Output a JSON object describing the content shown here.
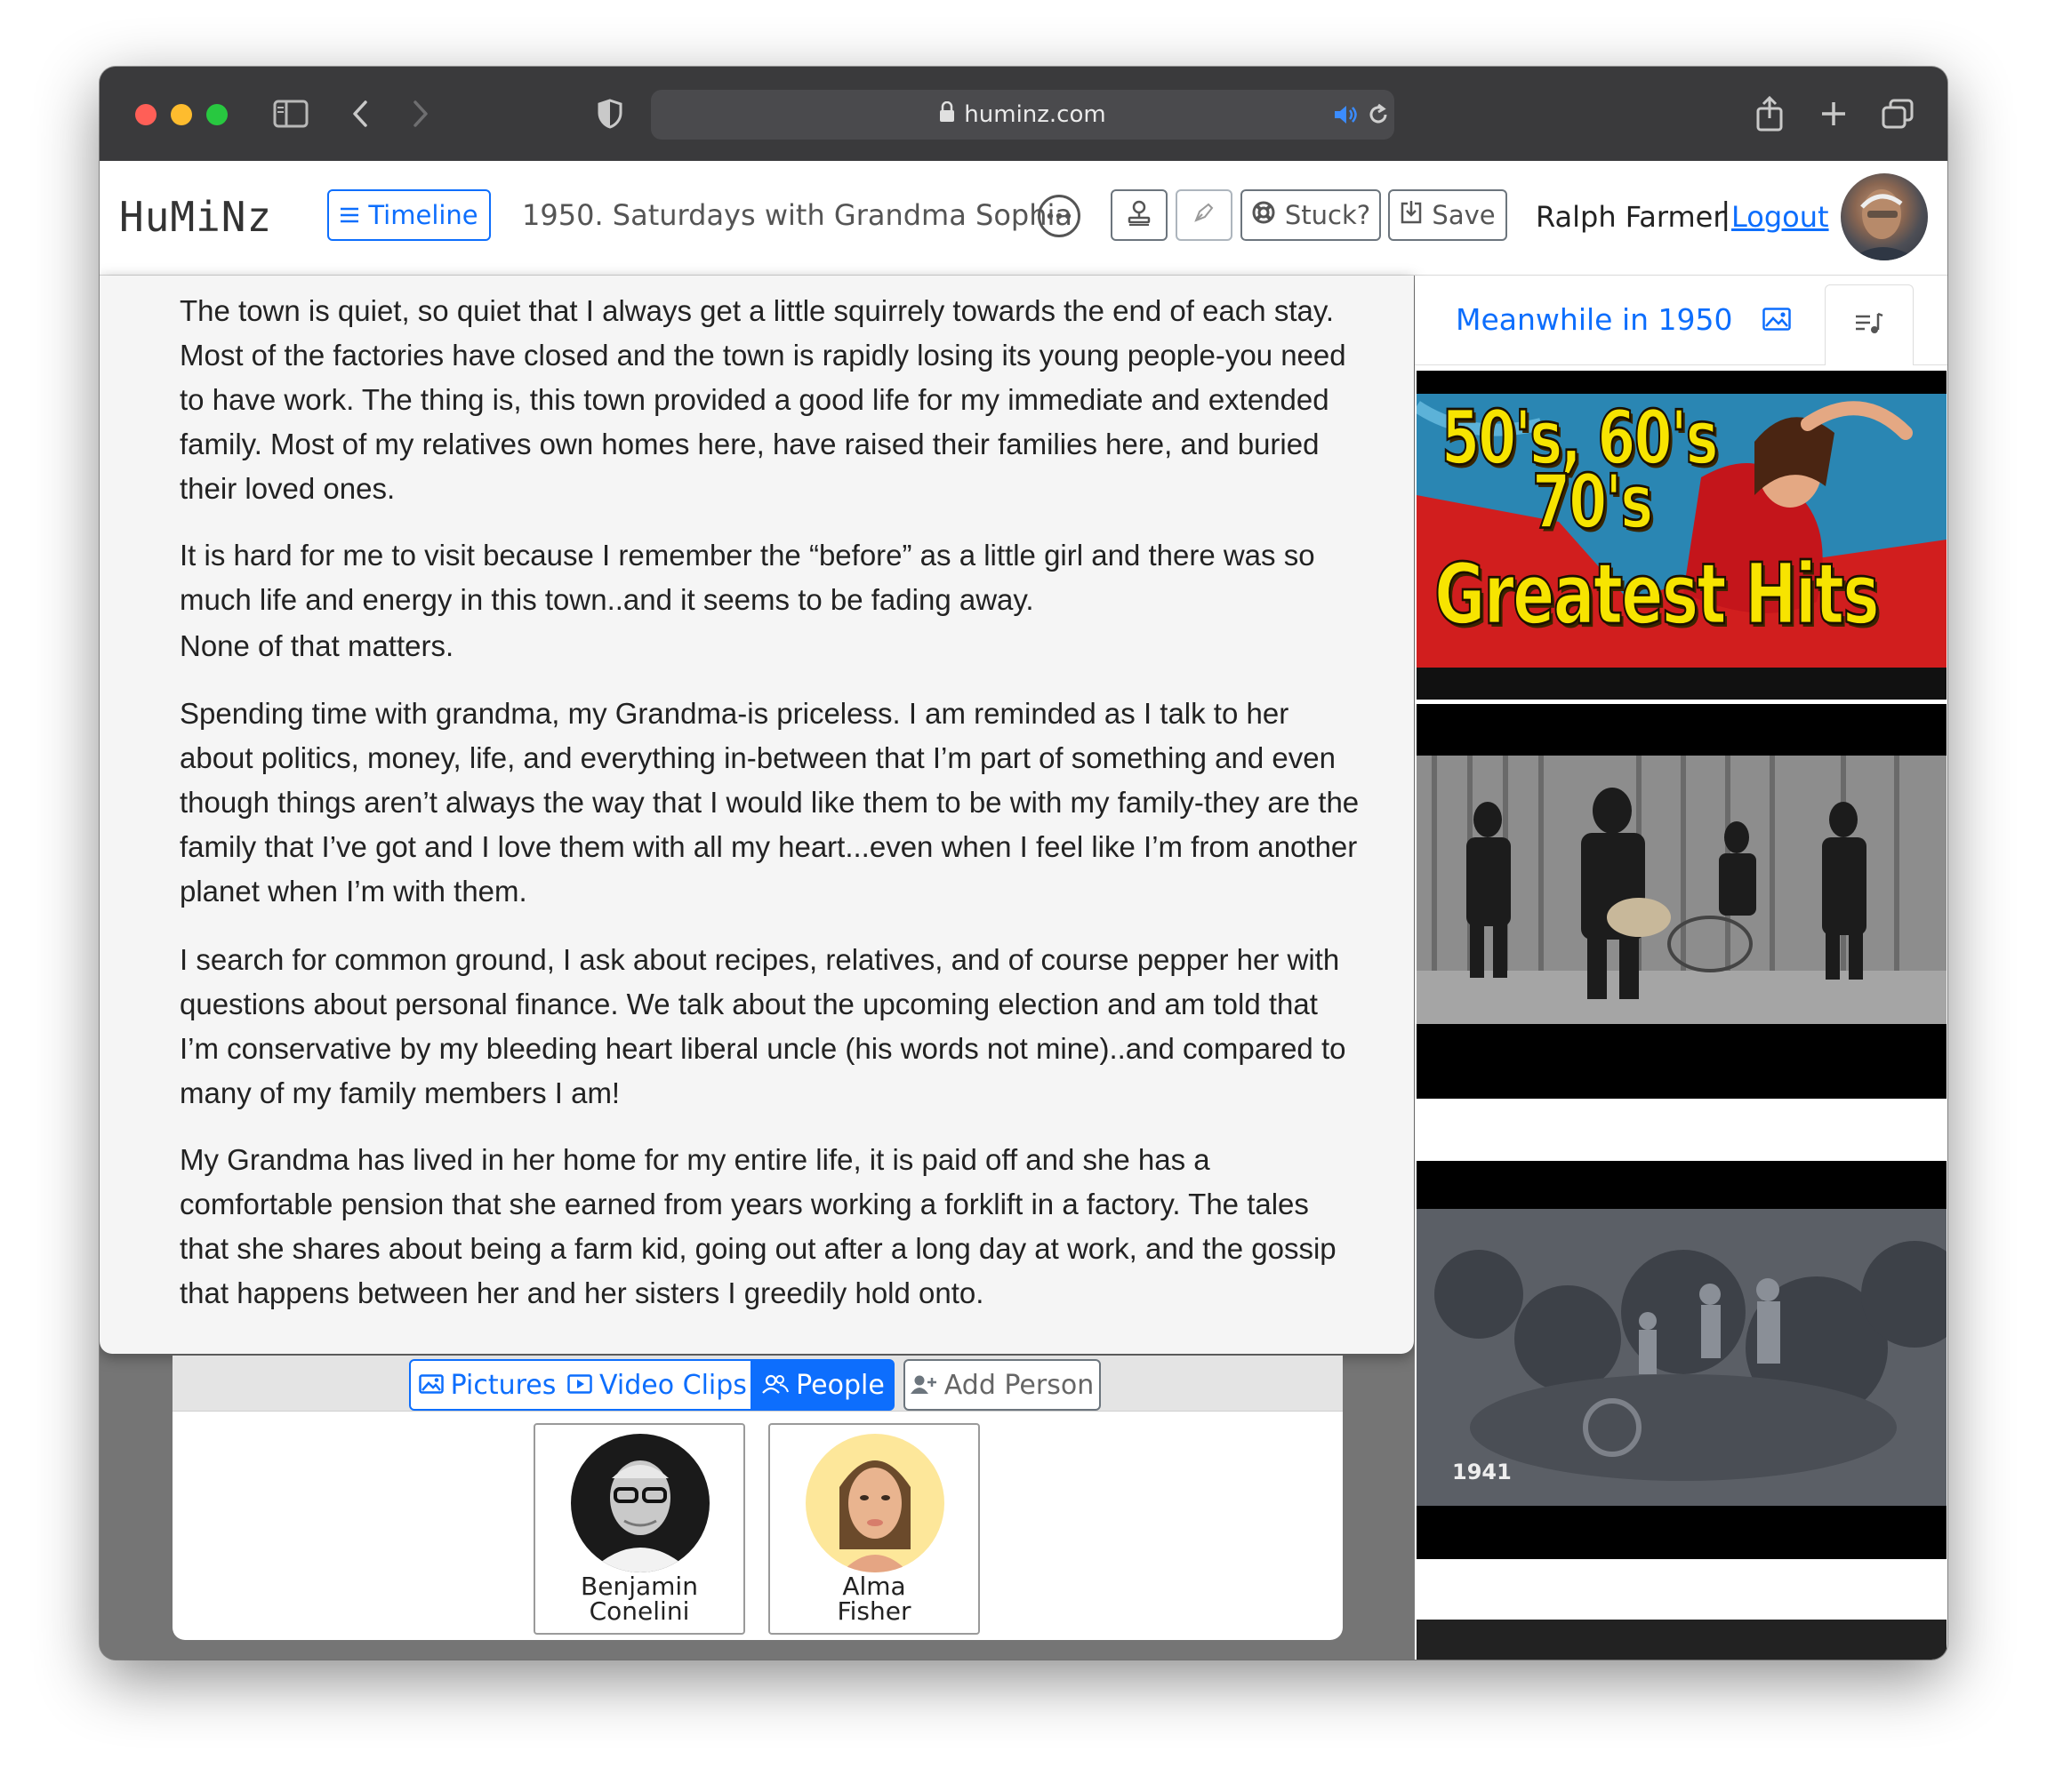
{
  "browser": {
    "url": "huminz.com",
    "icons": [
      "sidebar-toggle-icon",
      "back-arrow-icon",
      "forward-arrow-icon",
      "shield-icon",
      "lock-icon",
      "speaker-icon",
      "reload-icon",
      "share-icon",
      "new-tab-icon",
      "tabs-overview-icon"
    ]
  },
  "header": {
    "logo": "HuMiNz",
    "timeline_label": "Timeline",
    "title": "1950. Saturdays with Grandma Sophia",
    "stuck_label": "Stuck?",
    "save_label": "Save",
    "user_name": "Ralph Farmer",
    "separator": "|",
    "logout_label": "Logout"
  },
  "story": {
    "paragraphs": [
      "The town is quiet, so quiet that I always get a little squirrely towards the end of each stay. Most of the factories have closed and the town is rapidly losing its young people-you need to have work. The thing is, this town provided a good life for my immediate and extended family. Most of my relatives own homes here, have raised their families here, and buried their loved ones.",
      "It is hard for me to visit because I remember the “before” as a little girl and there was so much life and energy in this town..and it seems to be fading away.",
      "None of that matters.",
      "Spending time with grandma, my Grandma-is priceless. I am reminded as I talk to her about politics, money, life, and everything in-between that I’m part of something and even though things aren’t always the way that I would like them to be with my family-they are the family that I’ve got and I love them with all my heart...even when I feel like I’m from another planet when I’m with them.",
      "I search for common ground, I ask about recipes, relatives, and of course pepper her with questions about personal finance. We talk about the upcoming election and am told that I’m conservative by my bleeding heart liberal uncle (his words not mine)..and compared to many of my family members I am!",
      "My Grandma has lived in her home for my entire life, it is paid off and she has a comfortable pension that she earned from years working a forklift in a factory. The tales that she shares about being a farm kid, going out after a long day at work, and the gossip that happens between her and her sisters I greedily hold onto."
    ]
  },
  "media_tabs": {
    "pictures": "Pictures",
    "video_clips": "Video Clips",
    "people": "People",
    "add_person": "Add Person",
    "active": "People"
  },
  "people": [
    {
      "name_line1": "Benjamin",
      "name_line2": "Conelini"
    },
    {
      "name_line1": "Alma",
      "name_line2": "Fisher"
    }
  ],
  "sidebar": {
    "heading": "Meanwhile in 1950",
    "active_tab": "music",
    "videos": [
      {
        "thumb_line1": "50's, 60's",
        "thumb_line2": "70's",
        "thumb_line3": "Greatest Hits"
      },
      {
        "thumb_caption": ""
      },
      {
        "thumb_caption": "1941"
      }
    ]
  },
  "colors": {
    "accent": "#0d6efd",
    "titlebar": "#3a3a3c",
    "content_bg": "#757575",
    "story_bg": "#f5f5f5"
  }
}
